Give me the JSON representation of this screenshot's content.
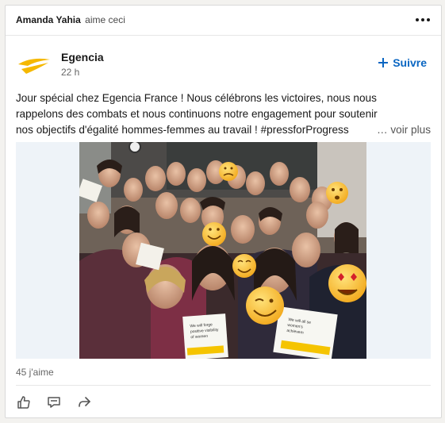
{
  "activity": {
    "actor": "Amanda Yahia",
    "verb": "aime ceci"
  },
  "post": {
    "author": "Egencia",
    "time": "22 h",
    "follow_label": "Suivre",
    "text_line1": "Jour spécial chez Egencia France ! Nous célébrons les victoires, nous nous",
    "text_line2": "rappelons des combats et nous continuons notre engagement pour soutenir",
    "text_line3": "nos objectifs d'égalité hommes-femmes au travail ! #pressforProgress",
    "see_more": "… voir plus",
    "sign_text": "We will forge positive visibility of women",
    "sign_hashtag": "#PressforProgress",
    "sign2_text": "We will all se women's achievem",
    "sign2_hashtag": "#PressforProg"
  },
  "social": {
    "likes": "45 j'aime"
  },
  "actions": [
    "like-icon",
    "comment-icon",
    "share-icon"
  ],
  "colors": {
    "brand_blue": "#0a66c2",
    "egencia_yellow": "#f5b800"
  }
}
